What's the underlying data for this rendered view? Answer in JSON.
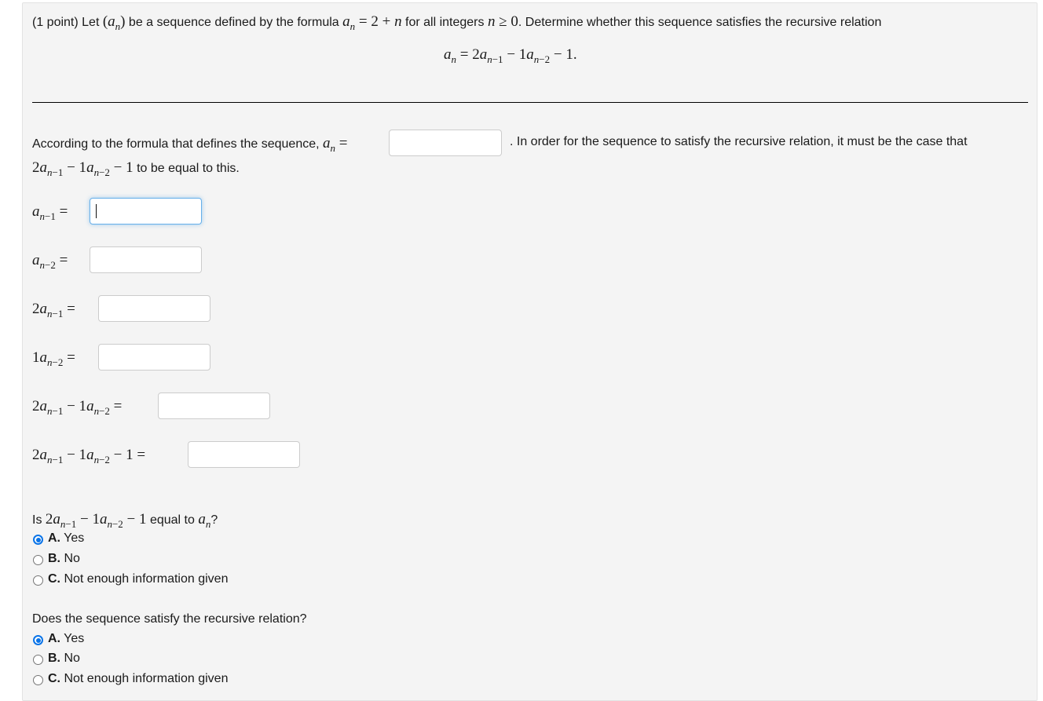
{
  "intro": {
    "prefix": "(1 point) Let ",
    "seq": "(a",
    "t1": " be a sequence defined by the formula ",
    "formula": "= 2 + n",
    "t2": " for all integers ",
    "cond": "n ≥ 0",
    "t3": ". Determine whether this sequence satisfies the recursive relation"
  },
  "relation": {
    "lhs": "a",
    "lhs_sub": "n",
    "eq": " = 2a",
    "sub1": "n−1",
    "mid": " − 1a",
    "sub2": "n−2",
    "tail": " − 1."
  },
  "para": {
    "text1": "According to the formula that defines the sequence, ",
    "text2": ". In order for the sequence to satisfy the recursive relation, it must be the case that",
    "text3": " to be equal to this."
  },
  "fields": [
    {
      "label": "a_{n-1}",
      "value": "",
      "focused": true
    },
    {
      "label": "a_{n-2}",
      "value": ""
    },
    {
      "label": "2a_{n-1}",
      "value": ""
    },
    {
      "label": "1a_{n-2}",
      "value": ""
    },
    {
      "label": "2a_{n-1} - 1a_{n-2}",
      "value": ""
    },
    {
      "label": "2a_{n-1} - 1a_{n-2} - 1",
      "value": ""
    }
  ],
  "q1": {
    "prefix": "Is ",
    "suffix": " equal to ",
    "end": "?",
    "options": [
      {
        "letter": "A.",
        "text": " Yes",
        "selected": true
      },
      {
        "letter": "B.",
        "text": " No",
        "selected": false
      },
      {
        "letter": "C.",
        "text": " Not enough information given",
        "selected": false
      }
    ]
  },
  "q2": {
    "question": "Does the sequence satisfy the recursive relation?",
    "options": [
      {
        "letter": "A.",
        "text": " Yes",
        "selected": true
      },
      {
        "letter": "B.",
        "text": " No",
        "selected": false
      },
      {
        "letter": "C.",
        "text": " Not enough information given",
        "selected": false
      }
    ]
  },
  "colors": {
    "accent": "#0a74e8",
    "panel": "#f4f4f4",
    "focus": "#66afe9"
  }
}
